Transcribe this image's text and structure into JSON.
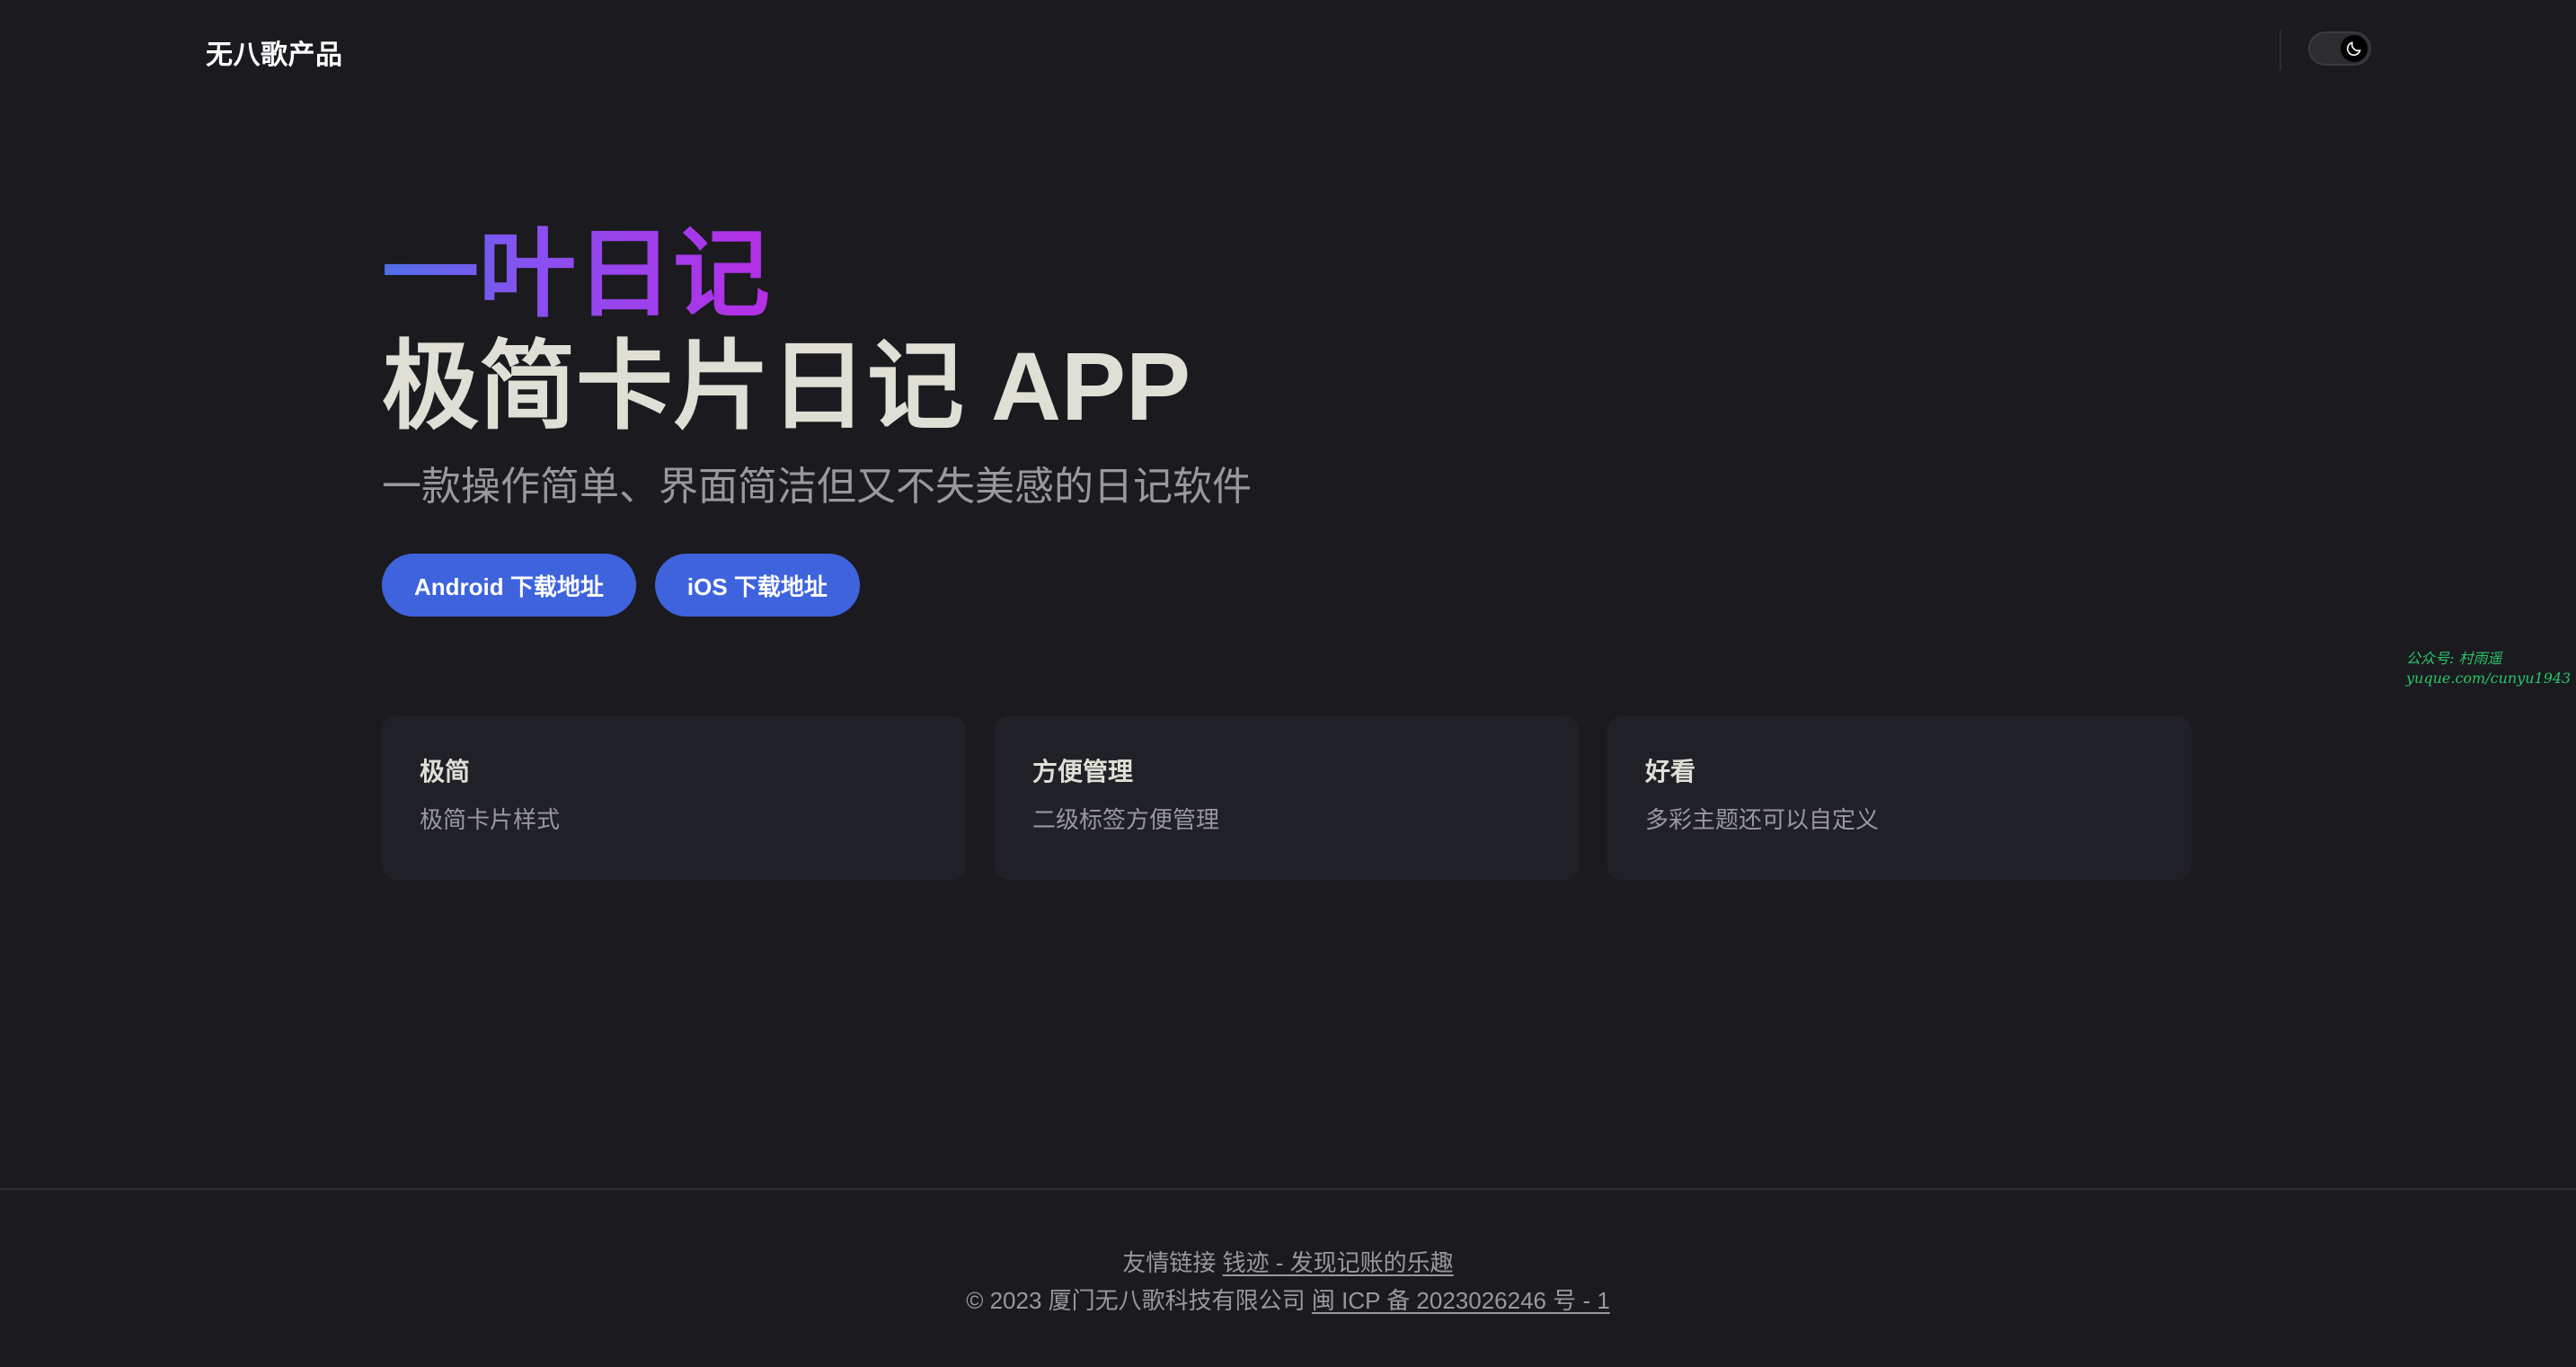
{
  "nav": {
    "brand": "无八歌产品",
    "theme_toggle_icon": "moon-icon"
  },
  "hero": {
    "name": "一叶日记",
    "text": "极简卡片日记 APP",
    "tagline": "一款操作简单、界面简洁但又不失美感的日记软件",
    "gradient_colors": [
      "#4f6fe8",
      "#8a4ff0",
      "#b52ee6"
    ]
  },
  "actions": [
    {
      "label": "Android 下载地址"
    },
    {
      "label": "iOS 下载地址"
    }
  ],
  "accent_color": "#3e63dd",
  "features": [
    {
      "title": "极简",
      "details": "极简卡片样式"
    },
    {
      "title": "方便管理",
      "details": "二级标签方便管理"
    },
    {
      "title": "好看",
      "details": "多彩主题还可以自定义"
    }
  ],
  "watermark": {
    "line1": "公众号: 村雨遥",
    "line2": "yuque.com/cunyu1943"
  },
  "footer": {
    "links_label": "友情链接",
    "links_text": "钱迹 - 发现记账的乐趣",
    "copyright": "© 2023 厦门无八歌科技有限公司",
    "icp": "闽 ICP 备 2023026246 号 - 1"
  }
}
